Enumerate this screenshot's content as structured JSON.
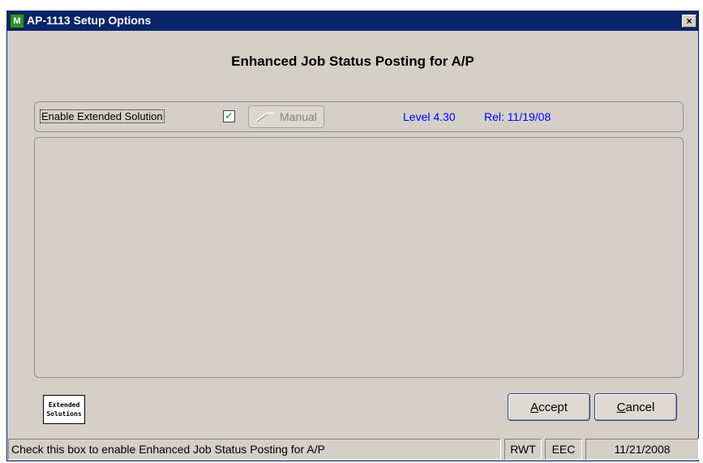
{
  "window": {
    "title": "AP-1113 Setup Options",
    "app_icon_glyph": "M",
    "close_glyph": "×"
  },
  "heading": "Enhanced Job Status Posting for A/P",
  "options": {
    "enable_label": "Enable Extended Solution",
    "enable_checked": true,
    "check_glyph": "✓",
    "manual_label": "Manual",
    "manual_enabled": false,
    "level": "Level 4.30",
    "release": "Rel: 11/19/08"
  },
  "logo": {
    "line1": "Extended",
    "line2": "Solutions"
  },
  "buttons": {
    "accept_mnemonic": "A",
    "accept_rest": "ccept",
    "cancel_mnemonic": "C",
    "cancel_rest": "ancel"
  },
  "status_bar": {
    "message": "Check this box to enable Enhanced Job Status Posting for A/P",
    "user": "RWT",
    "company": "EEC",
    "date": "11/21/2008"
  },
  "colors": {
    "titlebar": "#0a246a",
    "window_bg": "#d4d0c8",
    "link_text": "#0000ff",
    "check": "#1d8a1d"
  }
}
